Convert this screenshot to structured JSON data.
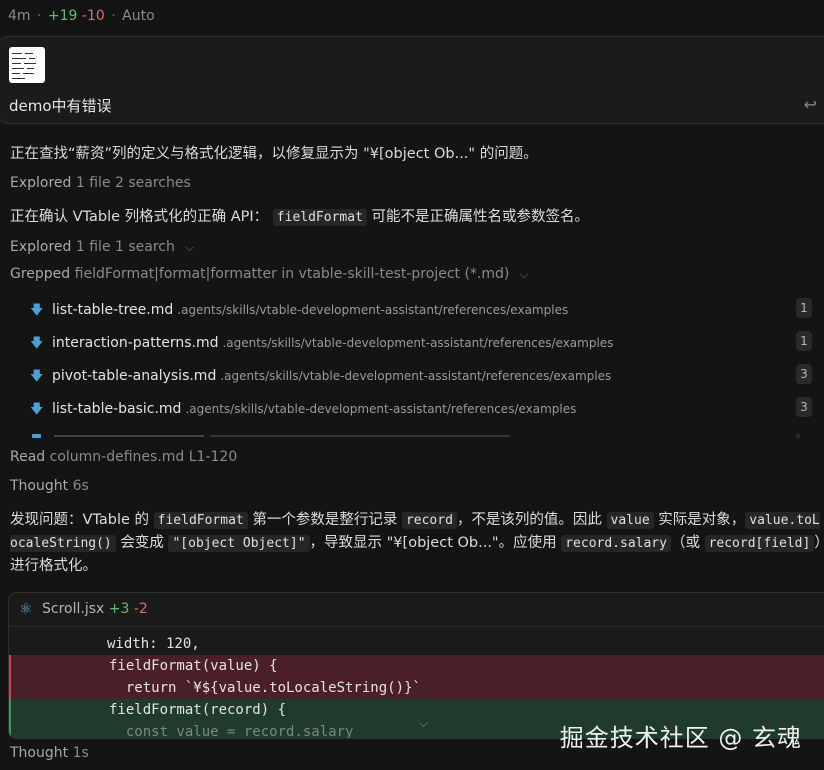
{
  "topbar": {
    "time": "4m",
    "additions": "+19",
    "deletions": "-10",
    "mode": "Auto"
  },
  "message": {
    "text": "demo中有错误",
    "undo_icon": "undo-icon"
  },
  "lines": {
    "search_text": "正在查找“薪资”列的定义与格式化逻辑，以修复显示为 \"¥[object Ob...\" 的问题。",
    "explored1_label": "Explored",
    "explored1_detail": "1 file 2 searches",
    "confirm_prefix": "正在确认 VTable 列格式化的正确 API：",
    "confirm_code": "fieldFormat",
    "confirm_suffix": "可能不是正确属性名或参数签名。",
    "explored2_label": "Explored",
    "explored2_detail": "1 file 1 search",
    "grepped_label": "Grepped",
    "grepped_detail": "fieldFormat|format|formatter in vtable-skill-test-project (*.md)"
  },
  "results": [
    {
      "name": "list-table-tree.md",
      "path": ".agents/skills/vtable-development-assistant/references/examples",
      "count": "1"
    },
    {
      "name": "interaction-patterns.md",
      "path": ".agents/skills/vtable-development-assistant/references/examples",
      "count": "1"
    },
    {
      "name": "pivot-table-analysis.md",
      "path": ".agents/skills/vtable-development-assistant/references/examples",
      "count": "3"
    },
    {
      "name": "list-table-basic.md",
      "path": ".agents/skills/vtable-development-assistant/references/examples",
      "count": "3"
    }
  ],
  "read": {
    "label": "Read",
    "detail": "column-defines.md L1-120"
  },
  "thought1": {
    "label": "Thought",
    "detail": "6s"
  },
  "finding": {
    "p1": "发现问题：VTable 的 ",
    "c1": "fieldFormat",
    "p2": " 第一个参数是整行记录 ",
    "c2": "record",
    "p3": "，不是该列的值。因此 ",
    "c3": "value",
    "p4": " 实际是对象，",
    "c4": "value.toLocaleString()",
    "p5": " 会变成 ",
    "c5": "\"[object Object]\"",
    "p6": "，导致显示 \"¥[object Ob...\"。应使用 ",
    "c6": "record.salary",
    "p7": "（或 ",
    "c7": "record[field]",
    "p8": "）进行格式化。"
  },
  "diff": {
    "file": "Scroll.jsx",
    "additions": "+3",
    "deletions": "-2",
    "lines": [
      {
        "type": "ctx",
        "text": "width: 120,"
      },
      {
        "type": "del",
        "text": "fieldFormat(value) {"
      },
      {
        "type": "del",
        "text": "  return `¥${value.toLocaleString()}`"
      },
      {
        "type": "add",
        "text": "fieldFormat(record) {"
      },
      {
        "type": "add",
        "text": "  const value = record.salary"
      }
    ]
  },
  "thought2": {
    "label": "Thought",
    "detail": "1s"
  },
  "watermark": "掘金技术社区 @ 玄魂",
  "colors": {
    "background": "#141414",
    "add": "#5fbf6a",
    "del": "#e06a6a",
    "file_icon": "#4aa3d8"
  }
}
